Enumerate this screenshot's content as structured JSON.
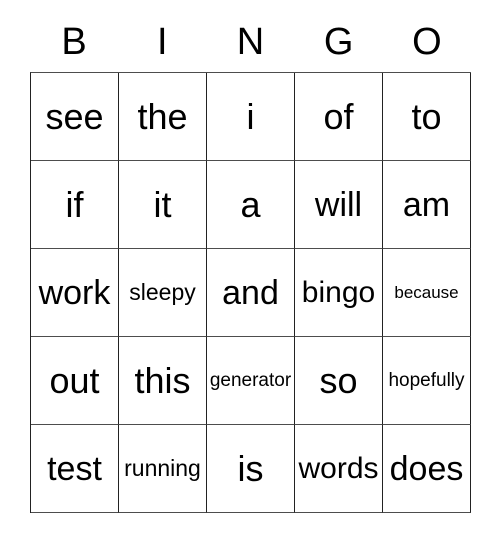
{
  "card": {
    "title": "BINGO",
    "header_letters": [
      "B",
      "I",
      "N",
      "G",
      "O"
    ],
    "columns": 5,
    "rows": 5,
    "border_color": "#222222",
    "background_color": "#ffffff",
    "text_color": "#000000",
    "grid": [
      [
        {
          "word": "see",
          "size": "s-xl"
        },
        {
          "word": "the",
          "size": "s-xl"
        },
        {
          "word": "i",
          "size": "s-xl"
        },
        {
          "word": "of",
          "size": "s-xl"
        },
        {
          "word": "to",
          "size": "s-xl"
        }
      ],
      [
        {
          "word": "if",
          "size": "s-xl"
        },
        {
          "word": "it",
          "size": "s-xl"
        },
        {
          "word": "a",
          "size": "s-xl"
        },
        {
          "word": "will",
          "size": "s-lg"
        },
        {
          "word": "am",
          "size": "s-lg"
        }
      ],
      [
        {
          "word": "work",
          "size": "s-lg"
        },
        {
          "word": "sleepy",
          "size": "s-sm"
        },
        {
          "word": "and",
          "size": "s-lg"
        },
        {
          "word": "bingo",
          "size": "s-md"
        },
        {
          "word": "because",
          "size": "s-xxs"
        }
      ],
      [
        {
          "word": "out",
          "size": "s-xl"
        },
        {
          "word": "this",
          "size": "s-xl"
        },
        {
          "word": "generator",
          "size": "s-xs"
        },
        {
          "word": "so",
          "size": "s-xl"
        },
        {
          "word": "hopefully",
          "size": "s-xs"
        }
      ],
      [
        {
          "word": "test",
          "size": "s-lg"
        },
        {
          "word": "running",
          "size": "s-sm"
        },
        {
          "word": "is",
          "size": "s-xl"
        },
        {
          "word": "words",
          "size": "s-md"
        },
        {
          "word": "does",
          "size": "s-lg"
        }
      ]
    ]
  }
}
